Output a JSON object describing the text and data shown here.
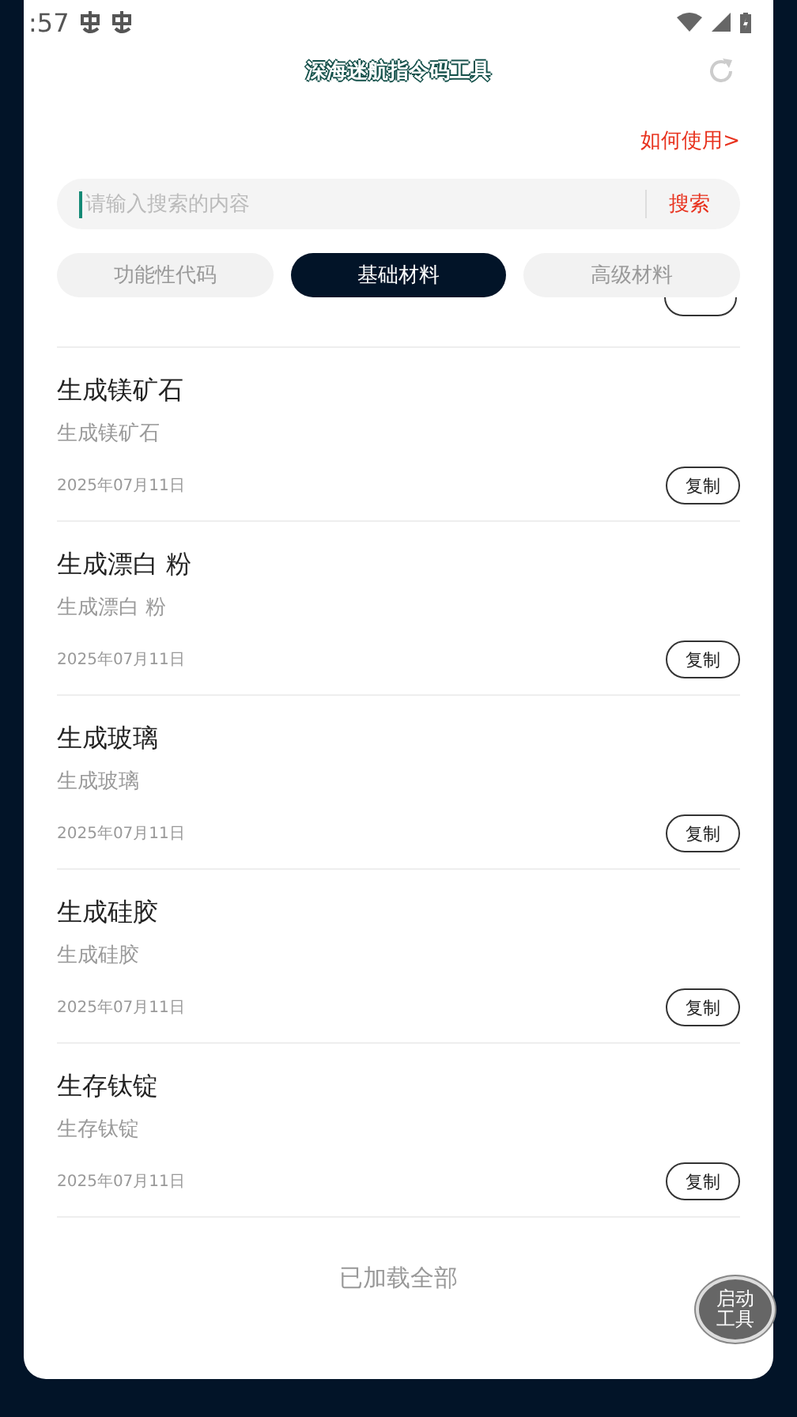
{
  "status_bar": {
    "time": ":57"
  },
  "header": {
    "title": "深海迷航指令码工具"
  },
  "help_link": "如何使用>",
  "search": {
    "placeholder": "请输入搜索的内容",
    "button": "搜索"
  },
  "tabs": [
    {
      "label": "功能性代码",
      "selected": false
    },
    {
      "label": "基础材料",
      "selected": true
    },
    {
      "label": "高级材料",
      "selected": false
    }
  ],
  "items": [
    {
      "title": "生成镁矿石",
      "subtitle": "生成镁矿石",
      "date": "2025年07月11日",
      "button": "复制"
    },
    {
      "title": "生成漂白 粉",
      "subtitle": "生成漂白 粉",
      "date": "2025年07月11日",
      "button": "复制"
    },
    {
      "title": "生成玻璃",
      "subtitle": "生成玻璃",
      "date": "2025年07月11日",
      "button": "复制"
    },
    {
      "title": "生成硅胶",
      "subtitle": "生成硅胶",
      "date": "2025年07月11日",
      "button": "复制"
    },
    {
      "title": "生存钛锭",
      "subtitle": "生存钛锭",
      "date": "2025年07月11日",
      "button": "复制"
    }
  ],
  "footer": "已加载全部",
  "fab": "启动工具"
}
